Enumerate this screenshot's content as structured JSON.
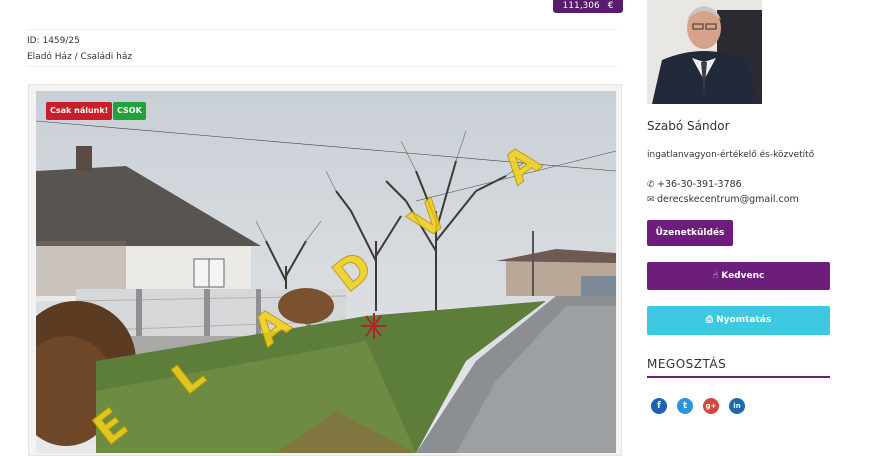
{
  "listing": {
    "price": "111,306",
    "currency": "€",
    "id": "ID: 1459/25",
    "category": "Eladó Ház / Családi ház"
  },
  "photo": {
    "tags": [
      "Csak nálunk!",
      "CSOK"
    ],
    "watermark": [
      "E",
      "L",
      "A",
      "D",
      "V",
      "A"
    ]
  },
  "agent": {
    "name": "Szabó Sándor",
    "role": "ingatlanvagyon-értékelő és-közvetítő",
    "phone": "+36-30-391-3786",
    "email": "derecskecentrum@gmail.com"
  },
  "buttons": {
    "message": "Üzenetküldés",
    "favorite": "Kedvenc",
    "print": "Nyomtatás"
  },
  "share": {
    "title": "MEGOSZTÁS",
    "networks": [
      "facebook-icon",
      "twitter-icon",
      "googleplus-icon",
      "linkedin-icon"
    ]
  },
  "colors": {
    "accent": "#6c1e7a",
    "print": "#3ec8e2",
    "tag_red": "#c81e2a",
    "tag_green": "#1fa23a",
    "watermark": "#f3d21a"
  }
}
